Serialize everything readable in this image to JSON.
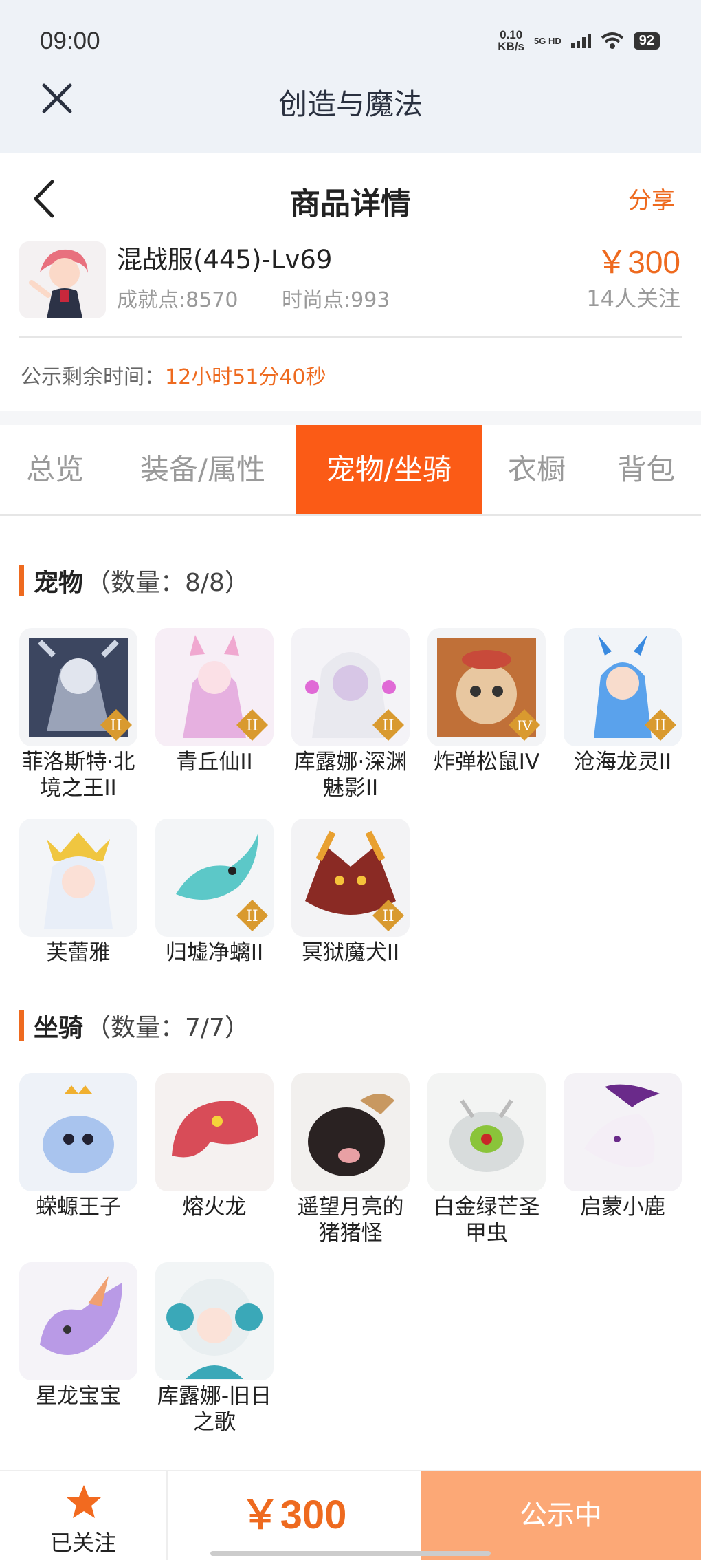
{
  "status_bar": {
    "time": "09:00",
    "net_speed": "0.10",
    "net_unit": "KB/s",
    "signal": "5G HD",
    "battery": "92"
  },
  "app_bar": {
    "title": "创造与魔法"
  },
  "header": {
    "title": "商品详情",
    "share_label": "分享"
  },
  "product": {
    "name": "混战服(445)-Lv69",
    "achievement": "成就点:8570",
    "fashion": "时尚点:993",
    "price": "￥300",
    "followers": "14人关注"
  },
  "countdown": {
    "label": "公示剩余时间：",
    "value": "12小时51分40秒"
  },
  "tabs": [
    {
      "label": "总览"
    },
    {
      "label": "装备/属性"
    },
    {
      "label": "宠物/坐骑"
    },
    {
      "label": "衣橱"
    },
    {
      "label": "背包"
    }
  ],
  "pets": {
    "title": "宠物",
    "count": "（数量：8/8）",
    "items": [
      {
        "name": "菲洛斯特·北境之王II",
        "badge": "II"
      },
      {
        "name": "青丘仙II",
        "badge": "II"
      },
      {
        "name": "库露娜·深渊魅影II",
        "badge": "II"
      },
      {
        "name": "炸弹松鼠IV",
        "badge": "IV"
      },
      {
        "name": "沧海龙灵II",
        "badge": "II"
      },
      {
        "name": "芙蕾雅",
        "badge": ""
      },
      {
        "name": "归墟净螭II",
        "badge": "II"
      },
      {
        "name": "冥狱魔犬II",
        "badge": "II"
      }
    ]
  },
  "mounts": {
    "title": "坐骑",
    "count": "（数量：7/7）",
    "items": [
      {
        "name": "蝾螈王子"
      },
      {
        "name": "熔火龙"
      },
      {
        "name": "遥望月亮的猪猪怪"
      },
      {
        "name": "白金绿芒圣甲虫"
      },
      {
        "name": "启蒙小鹿"
      },
      {
        "name": "星龙宝宝"
      },
      {
        "name": "库露娜-旧日之歌"
      }
    ]
  },
  "bottom_bar": {
    "follow_label": "已关注",
    "price": "￥300",
    "status_label": "公示中"
  },
  "colors": {
    "accent": "#ee6a1f",
    "tab_active": "#fb5b16",
    "status_button": "#fca876"
  }
}
